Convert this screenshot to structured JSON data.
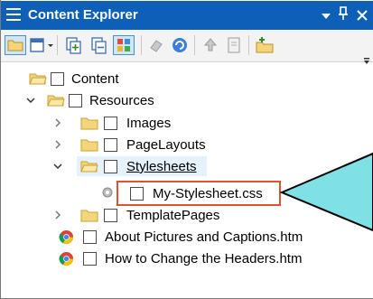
{
  "window": {
    "title": "Content Explorer",
    "menu_icon": "hamburger-menu-icon",
    "dropdown_icon": "chevron-down-icon",
    "pin_icon": "pin-icon",
    "pin_glyph": "2",
    "close_icon": "close-icon",
    "close_glyph": "×",
    "accent": "#0d5fb8"
  },
  "toolbar": {
    "buttons": [
      "open-folder-icon",
      "view-dropdown-icon",
      "new-file-icon",
      "copy-icon",
      "grid-view-icon",
      "properties-icon",
      "refresh-icon",
      "upload-icon",
      "document-icon",
      "new-folder-icon"
    ]
  },
  "tree": {
    "items": [
      {
        "label": "Content",
        "type": "folder",
        "depth": 0,
        "expanded": true
      },
      {
        "label": "Resources",
        "type": "folder",
        "depth": 1,
        "expanded": true
      },
      {
        "label": "Images",
        "type": "folder",
        "depth": 2,
        "expanded": false
      },
      {
        "label": "PageLayouts",
        "type": "folder",
        "depth": 2,
        "expanded": false
      },
      {
        "label": "Stylesheets",
        "type": "folder",
        "depth": 2,
        "expanded": true,
        "selected": true
      },
      {
        "label": "My-Stylesheet.css",
        "type": "css-file",
        "depth": 3,
        "highlighted": true
      },
      {
        "label": "TemplatePages",
        "type": "folder",
        "depth": 2,
        "expanded": false
      },
      {
        "label": "About Pictures and Captions.htm",
        "type": "chrome-file",
        "depth": 0
      },
      {
        "label": "How to Change the Headers.htm",
        "type": "chrome-file",
        "depth": 0
      }
    ]
  },
  "colors": {
    "highlight_border": "#e2532d",
    "callout_fill": "#7fe0e6",
    "folder_yellow": "#f5d57a",
    "selection_bg": "#e5f1fb"
  }
}
